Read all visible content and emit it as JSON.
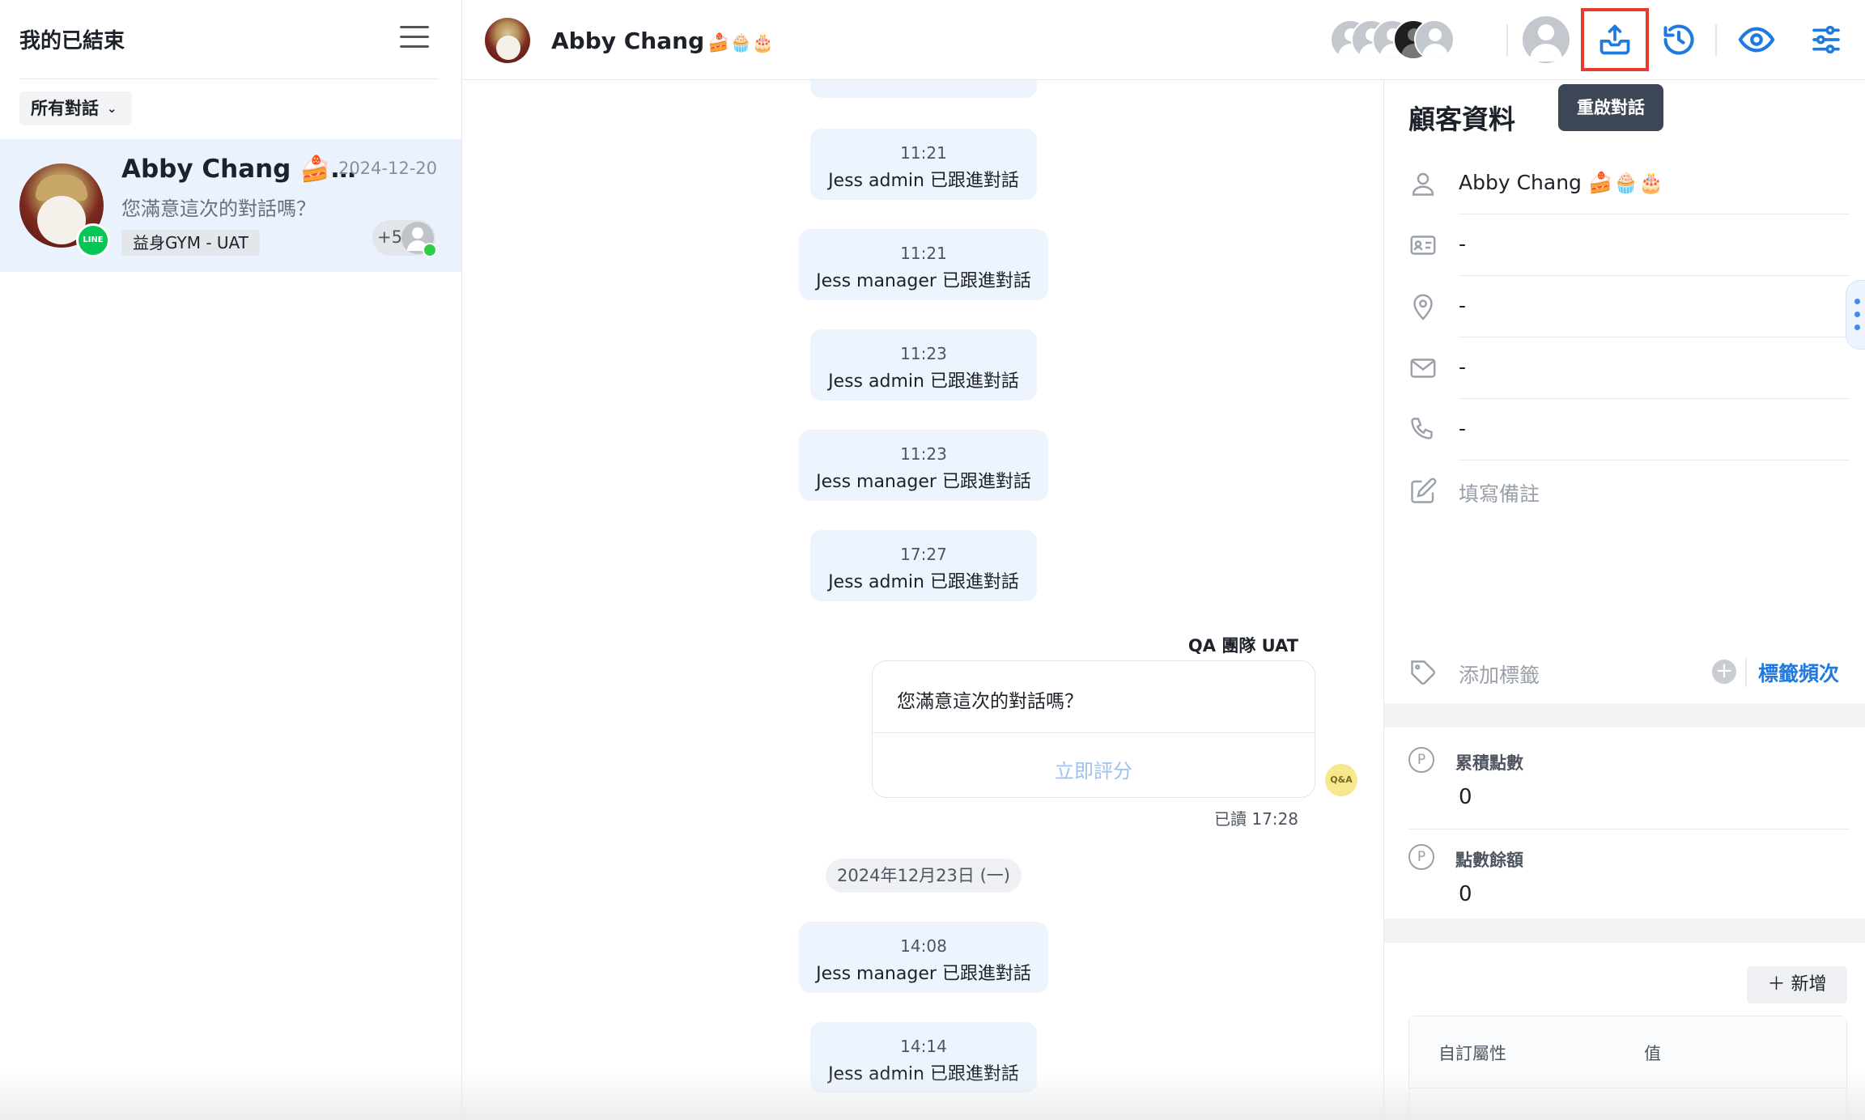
{
  "left_panel": {
    "title": "我的已結束",
    "filter_label": "所有對話",
    "conversation": {
      "name": "Abby Chang 🍰…",
      "date": "2024-12-20",
      "preview": "您滿意這次的對話嗎？",
      "tag": "益身GYM - UAT",
      "more_count": "+5",
      "channel_badge": "LINE"
    }
  },
  "header": {
    "name": "Abby Chang",
    "emojis": "🍰🧁🎂",
    "tooltip": "重啟對話"
  },
  "chat": {
    "messages": [
      {
        "time": "11:21",
        "text": "Jess admin  已跟進對話"
      },
      {
        "time": "11:21",
        "text": "Jess manager  已跟進對話"
      },
      {
        "time": "11:23",
        "text": "Jess admin  已跟進對話"
      },
      {
        "time": "11:23",
        "text": "Jess manager  已跟進對話"
      },
      {
        "time": "17:27",
        "text": "Jess admin  已跟進對話"
      },
      {
        "time": "14:08",
        "text": "Jess manager  已跟進對話"
      },
      {
        "time": "14:14",
        "text": "Jess admin  已跟進對話"
      }
    ],
    "sender": "QA 團隊 UAT",
    "survey_question": "您滿意這次的對話嗎？",
    "survey_action": "立即評分",
    "bot_avatar_text": "Q&A",
    "read_status": "已讀 17:28",
    "date_separator": "2024年12月23日 (一)"
  },
  "customer": {
    "title": "顧客資料",
    "name": "Abby Chang 🍰🧁🎂",
    "id_card": "-",
    "location": "-",
    "email": "-",
    "phone": "-",
    "note_placeholder": "填寫備註",
    "tag_placeholder": "添加標籤",
    "tag_frequency": "標籤頻次",
    "accumulated_points_label": "累積點數",
    "accumulated_points": "0",
    "point_balance_label": "點數餘額",
    "point_balance": "0",
    "add_button": "＋ 新增",
    "table_col_attr": "自訂屬性",
    "table_col_value": "值"
  },
  "colors": {
    "accent": "#1f7ae0",
    "highlight_box": "#e53c2d",
    "system_bubble": "#edf4fd",
    "line_green": "#06c755"
  }
}
